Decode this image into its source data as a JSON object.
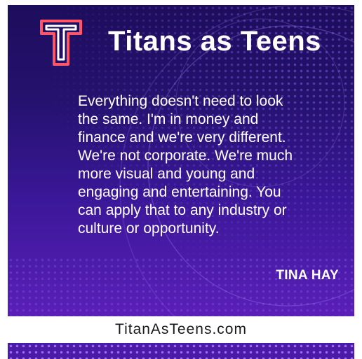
{
  "header": {
    "brand_title": "Titans as Teens",
    "logo_icon": "t-monogram-logo",
    "logo_colors": [
      "#ff5566",
      "#ffffff"
    ]
  },
  "quote": {
    "text": "Everything doesn't need to look\nthe same.  I'm in money and\nfinance and we're very different.\nWe're not corporate. We're much\nmore visual and young and\nengaging and entertaining. You\ncan apply that to any industry or\nculture or opportunity.",
    "author": "TINA HAY"
  },
  "footer": {
    "website": "TitanAsTeens.com"
  },
  "colors": {
    "background_top": "#1d0d5c",
    "background_bottom": "#5a1fb8",
    "dot_pattern": "#8a5ce8",
    "text": "#ffffff"
  }
}
